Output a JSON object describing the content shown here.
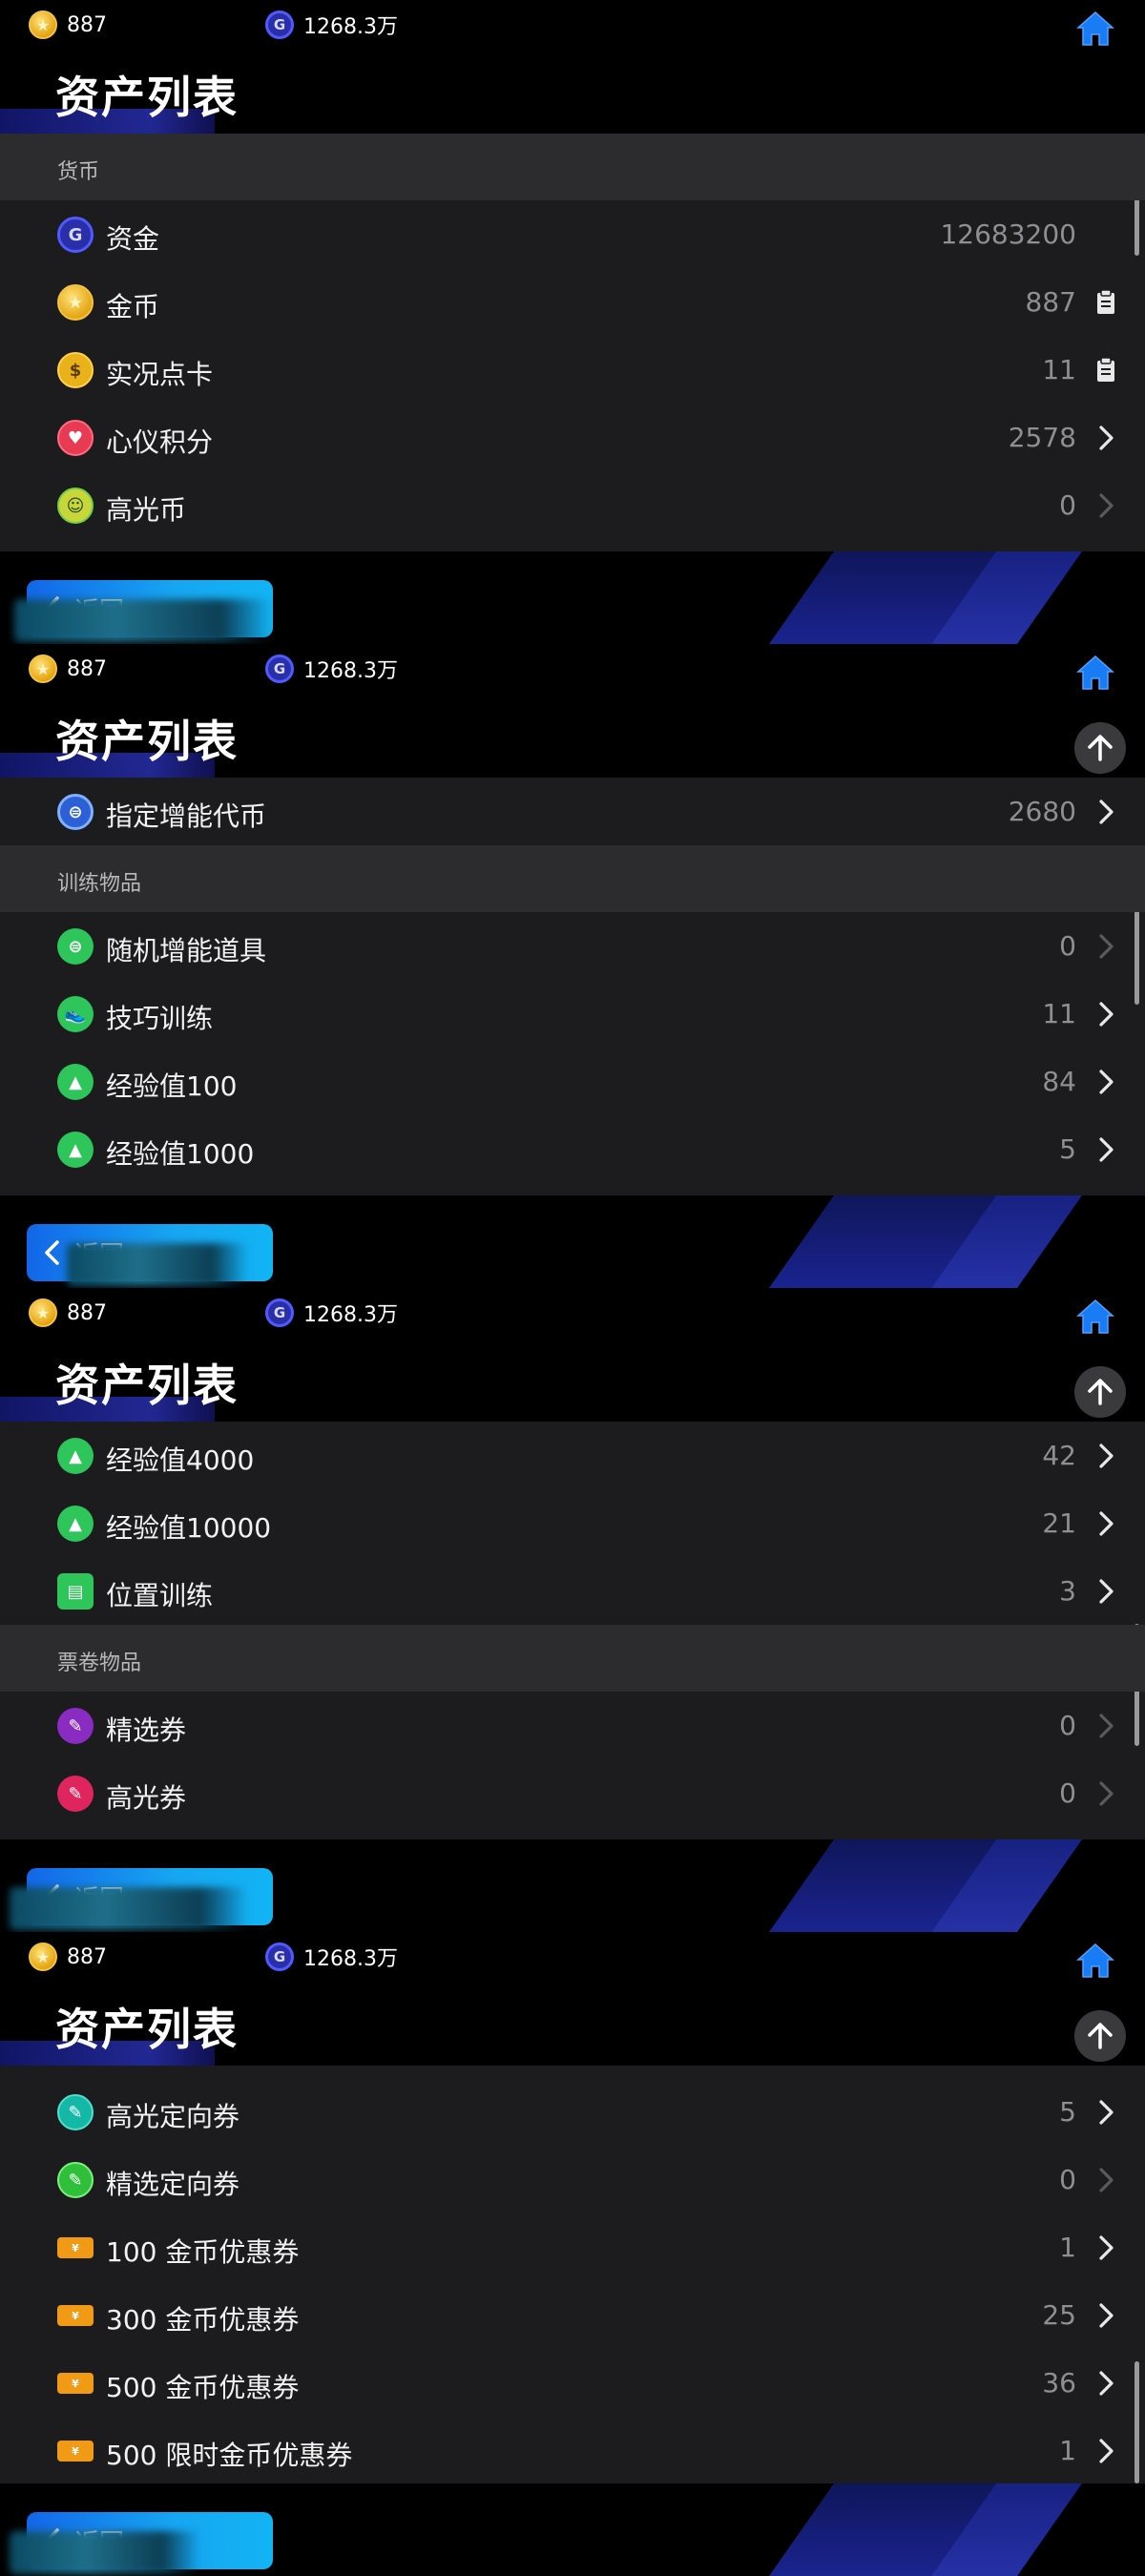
{
  "top_bar": {
    "coins": "887",
    "gold": "1268.3万"
  },
  "title": "资产列表",
  "back_label": "返回",
  "panels": [
    {
      "sections": [
        {
          "header": "货币",
          "items": [
            {
              "label": "资金",
              "count": "12683200",
              "icon": "gold-g-icon",
              "action": "none"
            },
            {
              "label": "金币",
              "count": "887",
              "icon": "coin-star-icon",
              "action": "clipboard"
            },
            {
              "label": "实况点卡",
              "count": "11",
              "icon": "dollar-coin-icon",
              "action": "clipboard"
            },
            {
              "label": "心仪积分",
              "count": "2578",
              "icon": "heart-icon",
              "action": "chevron"
            },
            {
              "label": "高光币",
              "count": "0",
              "icon": "highlight-coin-icon",
              "action": "chevron-dim"
            }
          ]
        }
      ]
    },
    {
      "sections": [
        {
          "header": "",
          "items": [
            {
              "label": "指定增能代币",
              "count": "2680",
              "icon": "boost-token-icon",
              "action": "chevron"
            }
          ]
        },
        {
          "header": "训练物品",
          "items": [
            {
              "label": "随机增能道具",
              "count": "0",
              "icon": "random-boost-icon",
              "action": "chevron-dim"
            },
            {
              "label": "技巧训练",
              "count": "11",
              "icon": "shoe-icon",
              "action": "chevron"
            },
            {
              "label": "经验值100",
              "count": "84",
              "icon": "cone-icon",
              "action": "chevron"
            },
            {
              "label": "经验值1000",
              "count": "5",
              "icon": "cone-icon",
              "action": "chevron"
            }
          ]
        }
      ]
    },
    {
      "sections": [
        {
          "header": "",
          "items": [
            {
              "label": "经验值4000",
              "count": "42",
              "icon": "cone-icon",
              "action": "chevron"
            },
            {
              "label": "经验值10000",
              "count": "21",
              "icon": "cone-icon",
              "action": "chevron"
            },
            {
              "label": "位置训练",
              "count": "3",
              "icon": "tactic-board-icon",
              "action": "chevron"
            }
          ]
        },
        {
          "header": "票卷物品",
          "items": [
            {
              "label": "精选券",
              "count": "0",
              "icon": "purple-ticket-icon",
              "action": "chevron-dim"
            },
            {
              "label": "高光券",
              "count": "0",
              "icon": "pink-ticket-icon",
              "action": "chevron-dim"
            }
          ]
        }
      ]
    },
    {
      "sections": [
        {
          "header": "",
          "items": [
            {
              "label": "高光定向券",
              "count": "5",
              "icon": "teal-ticket-icon",
              "action": "chevron"
            },
            {
              "label": "精选定向券",
              "count": "0",
              "icon": "green-ticket-icon",
              "action": "chevron-dim"
            },
            {
              "label": "100 金币优惠券",
              "count": "1",
              "icon": "orange-coupon-icon",
              "action": "chevron"
            },
            {
              "label": "300 金币优惠券",
              "count": "25",
              "icon": "orange-coupon-icon",
              "action": "chevron"
            },
            {
              "label": "500 金币优惠券",
              "count": "36",
              "icon": "orange-coupon-icon",
              "action": "chevron"
            },
            {
              "label": "500 限时金币优惠券",
              "count": "1",
              "icon": "orange-coupon-icon",
              "action": "chevron"
            }
          ]
        }
      ]
    }
  ]
}
